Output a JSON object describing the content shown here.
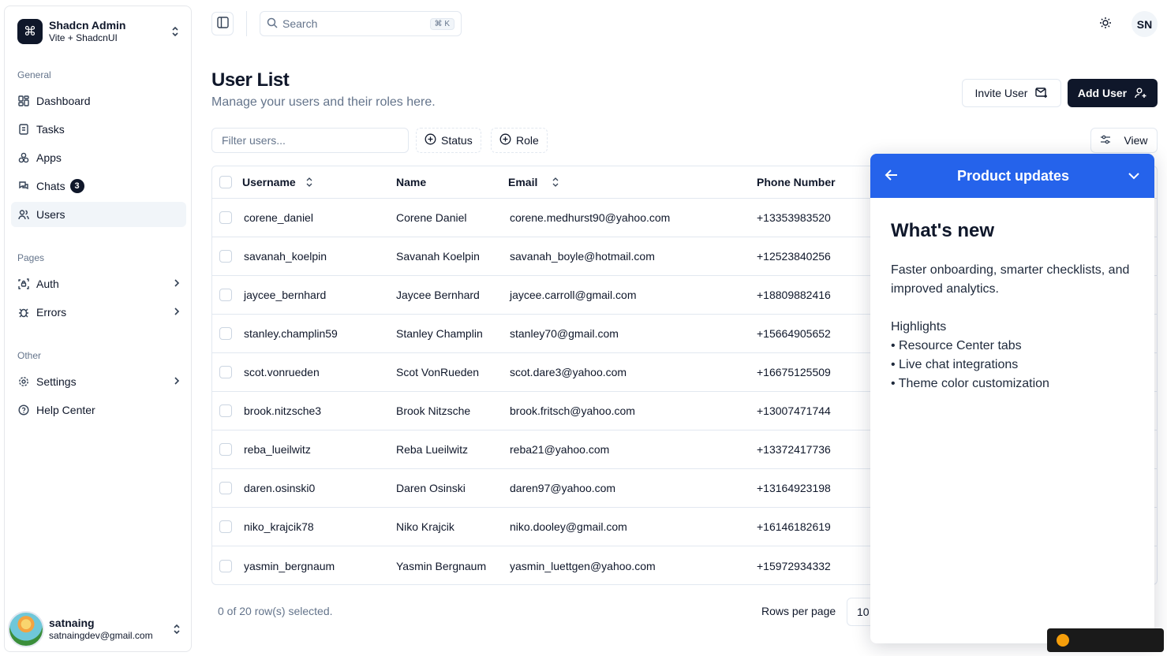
{
  "team": {
    "name": "Shadcn Admin",
    "subtitle": "Vite + ShadcnUI",
    "logo_icon": "command-icon"
  },
  "sidebar": {
    "groups": [
      {
        "label": "General"
      },
      {
        "label": "Pages"
      },
      {
        "label": "Other"
      }
    ],
    "items": [
      {
        "label": "Dashboard",
        "icon": "layout-dashboard-icon"
      },
      {
        "label": "Tasks",
        "icon": "list-todo-icon"
      },
      {
        "label": "Apps",
        "icon": "packages-icon"
      },
      {
        "label": "Chats",
        "icon": "messages-icon",
        "badge": "3"
      },
      {
        "label": "Users",
        "icon": "users-icon",
        "active": true
      },
      {
        "label": "Auth",
        "icon": "lock-access-icon"
      },
      {
        "label": "Errors",
        "icon": "bug-icon"
      },
      {
        "label": "Settings",
        "icon": "settings-icon"
      },
      {
        "label": "Help Center",
        "icon": "help-icon"
      }
    ]
  },
  "user": {
    "name": "satnaing",
    "email": "satnaingdev@gmail.com"
  },
  "header": {
    "search_placeholder": "Search",
    "search_shortcut": "⌘ K",
    "avatar_initials": "SN"
  },
  "page": {
    "title": "User List",
    "subtitle": "Manage your users and their roles here.",
    "invite_label": "Invite User",
    "add_label": "Add User"
  },
  "toolbar": {
    "filter_placeholder": "Filter users...",
    "status_label": "Status",
    "role_label": "Role",
    "view_label": "View"
  },
  "table": {
    "columns": [
      "Username",
      "Name",
      "Email",
      "Phone Number"
    ],
    "rows": [
      {
        "username": "corene_daniel",
        "name": "Corene Daniel",
        "email": "corene.medhurst90@yahoo.com",
        "phone": "+13353983520"
      },
      {
        "username": "savanah_koelpin",
        "name": "Savanah Koelpin",
        "email": "savanah_boyle@hotmail.com",
        "phone": "+12523840256"
      },
      {
        "username": "jaycee_bernhard",
        "name": "Jaycee Bernhard",
        "email": "jaycee.carroll@gmail.com",
        "phone": "+18809882416"
      },
      {
        "username": "stanley.champlin59",
        "name": "Stanley Champlin",
        "email": "stanley70@gmail.com",
        "phone": "+15664905652"
      },
      {
        "username": "scot.vonrueden",
        "name": "Scot VonRueden",
        "email": "scot.dare3@yahoo.com",
        "phone": "+16675125509"
      },
      {
        "username": "brook.nitzsche3",
        "name": "Brook Nitzsche",
        "email": "brook.fritsch@yahoo.com",
        "phone": "+13007471744"
      },
      {
        "username": "reba_lueilwitz",
        "name": "Reba Lueilwitz",
        "email": "reba21@yahoo.com",
        "phone": "+13372417736"
      },
      {
        "username": "daren.osinski0",
        "name": "Daren Osinski",
        "email": "daren97@yahoo.com",
        "phone": "+13164923198"
      },
      {
        "username": "niko_krajcik78",
        "name": "Niko Krajcik",
        "email": "niko.dooley@gmail.com",
        "phone": "+16146182619"
      },
      {
        "username": "yasmin_bergnaum",
        "name": "Yasmin Bergnaum",
        "email": "yasmin_luettgen@yahoo.com",
        "phone": "+15972934332"
      }
    ]
  },
  "footer": {
    "selection": "0 of 20 row(s) selected.",
    "rows_per_page_label": "Rows per page",
    "rows_per_page_value": "10"
  },
  "panel": {
    "header_title": "Product updates",
    "heading": "What's new",
    "paragraph": "Faster onboarding, smarter checklists, and improved analytics.",
    "highlights_title": "Highlights",
    "highlights": [
      "• Resource Center tabs",
      "• Live chat integrations",
      "• Theme color customization"
    ],
    "accent_color": "#2563eb"
  }
}
